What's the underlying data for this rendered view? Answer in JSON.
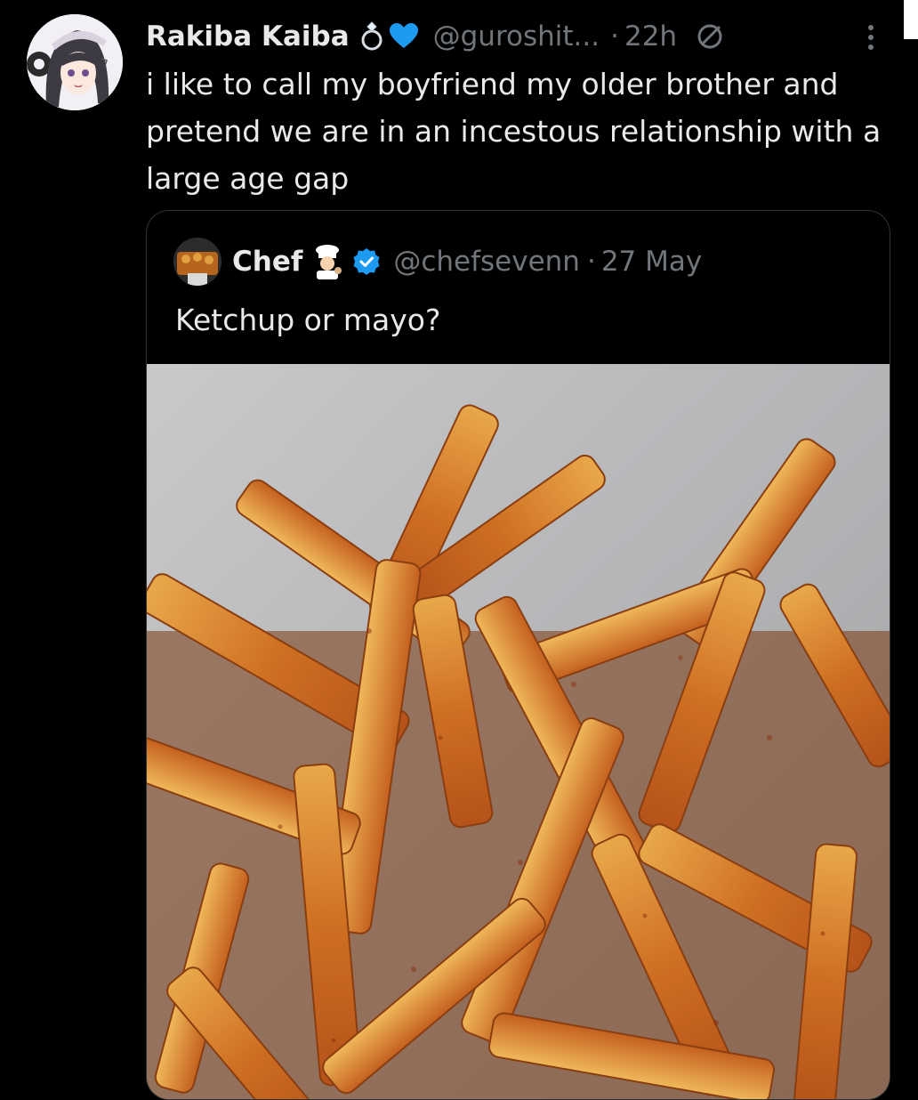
{
  "tweet": {
    "author_name": "Rakiba Kaiba",
    "author_handle": "@guroshit...",
    "separator": "·",
    "time": "22h",
    "text": "i like to call my boyfriend my older brother and pretend we are in an incestous relationship with a large age gap",
    "badges": [
      "ring-emoji-icon",
      "blue-heart-emoji-icon"
    ]
  },
  "quoted": {
    "author_name": "Chef",
    "author_handle": "@chefsevenn",
    "separator": "·",
    "date": "27 May",
    "text": "Ketchup or mayo?",
    "badges": [
      "chef-emoji-icon",
      "verified-badge-icon"
    ],
    "media": "french-fries-photo"
  },
  "colors": {
    "background": "#000000",
    "primary_text": "#e7e9ea",
    "secondary_text": "#71767b",
    "border": "#2f3336",
    "verified": "#1d9bf0",
    "heart": "#1d9bf0"
  }
}
